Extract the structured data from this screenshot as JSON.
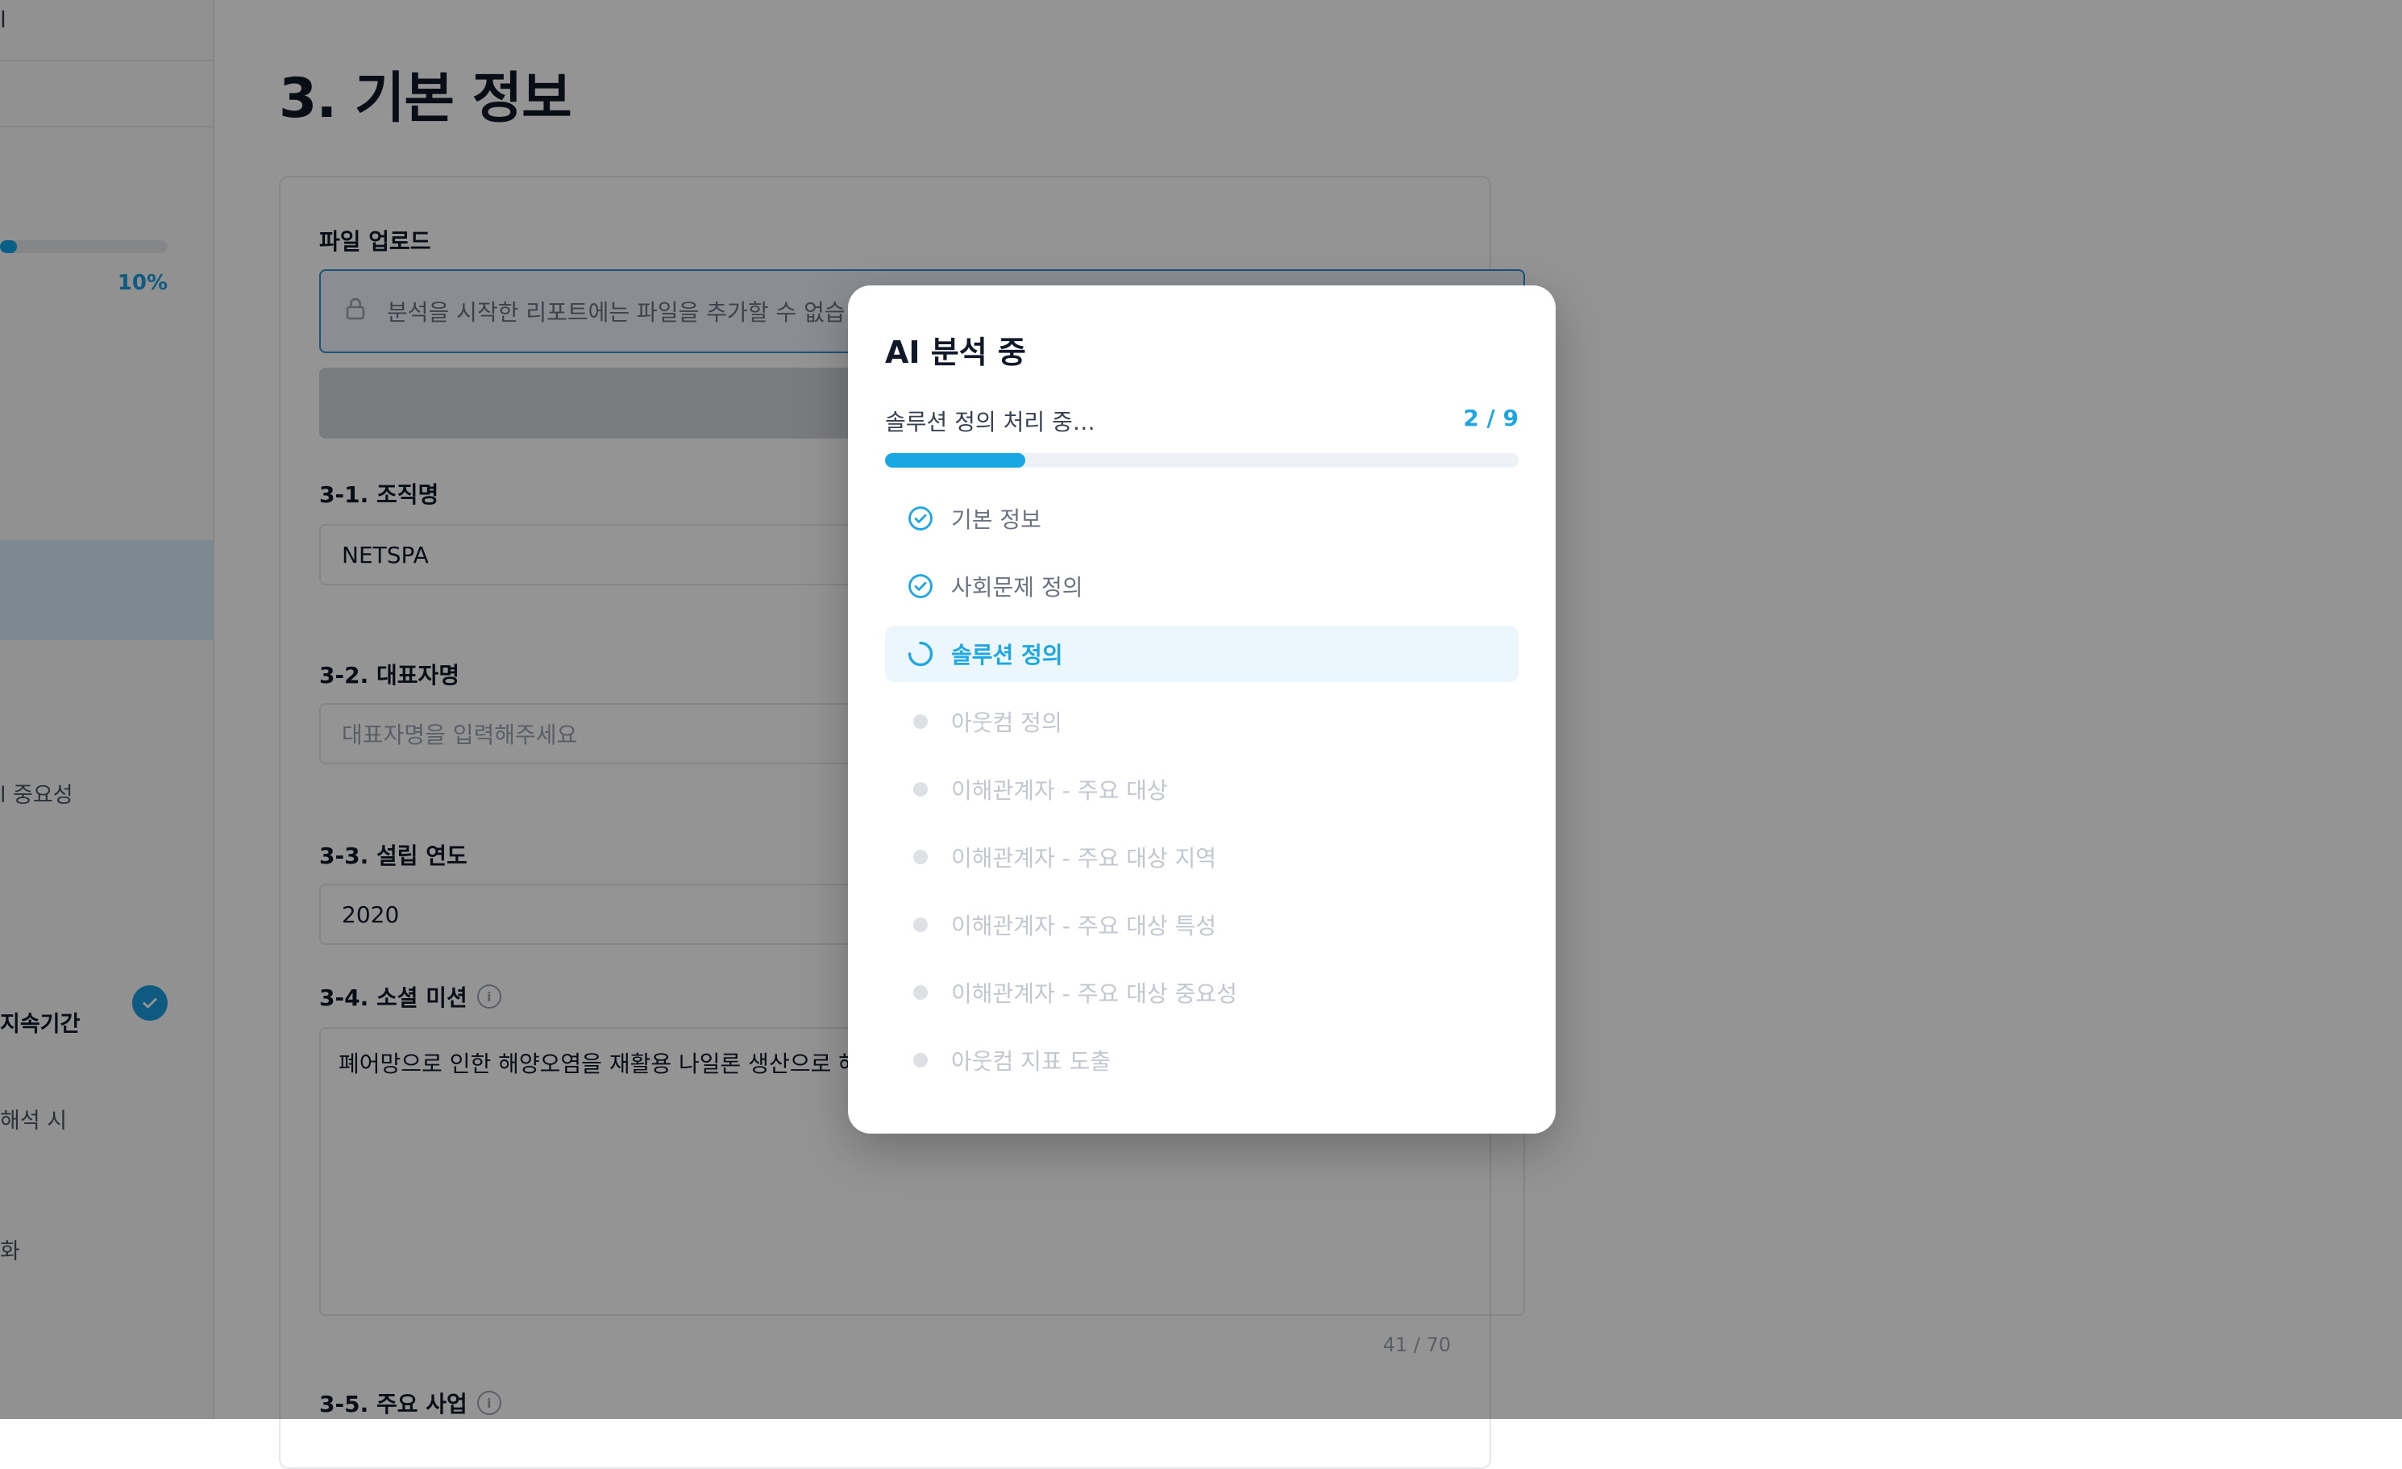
{
  "sidebar": {
    "top_text": "l",
    "progress_percent": 10,
    "progress_label": "10%",
    "items": [
      {
        "label": "l 중요성",
        "bold": false
      },
      {
        "label": "지속기간",
        "bold": true,
        "checked": true
      },
      {
        "label": "해석 시",
        "bold": false
      },
      {
        "label": "화",
        "bold": false
      }
    ]
  },
  "page": {
    "title": "3. 기본 정보",
    "upload_label": "파일 업로드",
    "upload_notice": "분석을 시작한 리포트에는 파일을 추가할 수 없습",
    "fields": {
      "org_label": "3-1. 조직명",
      "org_value": "NETSPA",
      "ceo_label": "3-2. 대표자명",
      "ceo_placeholder": "대표자명을 입력해주세요",
      "year_label": "3-3. 설립 연도",
      "year_value": "2020",
      "mission_label": "3-4. 소셜 미션",
      "mission_value": "폐어망으로 인한 해양오염을 재활용 나일론 생산으로 해",
      "mission_count": "41 / 70",
      "business_label": "3-5. 주요 사업"
    }
  },
  "modal": {
    "title": "AI 분석 중",
    "status": "솔루션 정의 처리 중…",
    "count": "2 / 9",
    "progress_fraction": 0.222,
    "colors": {
      "accent": "#1ea7e1",
      "done": "#6b7280",
      "pending": "#c2c7cf"
    },
    "steps": [
      {
        "label": "기본 정보",
        "state": "done"
      },
      {
        "label": "사회문제 정의",
        "state": "done"
      },
      {
        "label": "솔루션 정의",
        "state": "active"
      },
      {
        "label": "아웃컴 정의",
        "state": "pending"
      },
      {
        "label": "이해관계자 - 주요 대상",
        "state": "pending"
      },
      {
        "label": "이해관계자 - 주요 대상 지역",
        "state": "pending"
      },
      {
        "label": "이해관계자 - 주요 대상 특성",
        "state": "pending"
      },
      {
        "label": "이해관계자 - 주요 대상 중요성",
        "state": "pending"
      },
      {
        "label": "아웃컴 지표 도출",
        "state": "pending"
      }
    ]
  }
}
